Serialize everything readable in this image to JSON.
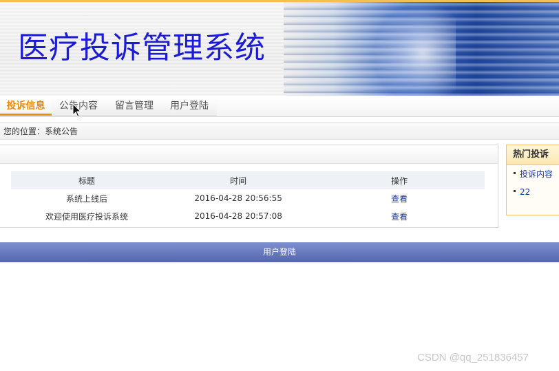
{
  "header": {
    "site_title": "医疗投诉管理系统"
  },
  "nav": {
    "tabs": [
      {
        "label": "投诉信息",
        "active": true
      },
      {
        "label": "公告内容",
        "active": false
      },
      {
        "label": "留言管理",
        "active": false
      },
      {
        "label": "用户登陆",
        "active": false
      }
    ]
  },
  "breadcrumb": {
    "text": "您的位置：系统公告"
  },
  "notice_table": {
    "columns": [
      "标题",
      "时间",
      "操作"
    ],
    "rows": [
      {
        "title": "系统上线后",
        "time": "2016-04-28 20:56:55",
        "action": "查看"
      },
      {
        "title": "欢迎使用医疗投诉系统",
        "time": "2016-04-28 20:57:08",
        "action": "查看"
      }
    ]
  },
  "sidebar": {
    "title": "热门投诉",
    "items": [
      "投诉内容",
      "22"
    ]
  },
  "footer": {
    "label": "用户登陆"
  },
  "watermark": "CSDN @qq_251836457",
  "colors": {
    "active_tab": "#ef8a10",
    "title": "#1c1cd6",
    "link": "#1d3b9a",
    "footer_bar": "#5466ad"
  }
}
